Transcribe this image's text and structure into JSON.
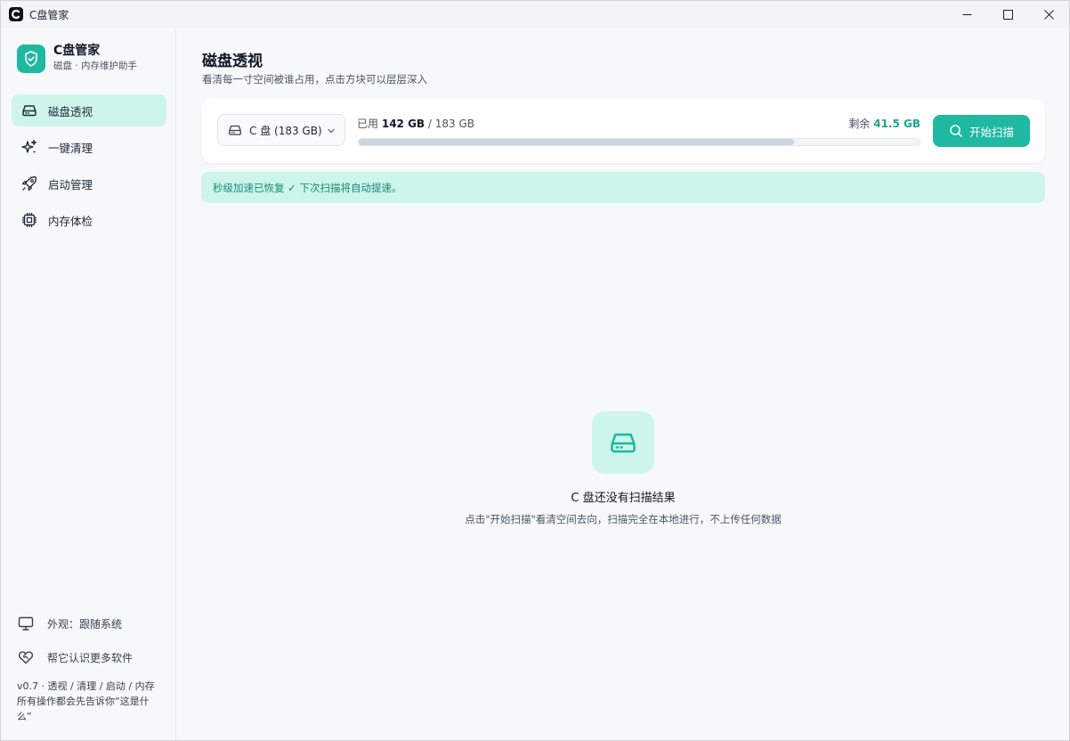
{
  "window": {
    "title": "C盘管家"
  },
  "brand": {
    "name": "C盘管家",
    "subtitle": "磁盘 · 内存维护助手"
  },
  "nav": [
    {
      "label": "磁盘透视",
      "icon": "hard-drive-icon",
      "active": true
    },
    {
      "label": "一键清理",
      "icon": "sparkles-icon",
      "active": false
    },
    {
      "label": "启动管理",
      "icon": "rocket-icon",
      "active": false
    },
    {
      "label": "内存体检",
      "icon": "cpu-chip-icon",
      "active": false
    }
  ],
  "sidebar_bottom": {
    "appearance_label": "外观：跟随系统",
    "appearance_icon": "monitor-icon",
    "share_label": "帮它认识更多软件",
    "share_icon": "heart-handshake-icon",
    "version_note": "v0.7 · 透视 / 清理 / 启动 / 内存 所有操作都会先告诉你“这是什么”"
  },
  "page": {
    "title": "磁盘透视",
    "subtitle": "看清每一寸空间被谁占用，点击方块可以层层深入"
  },
  "disk": {
    "selected_drive": "C 盘 (183 GB)",
    "used_label": "已用",
    "used_value": "142 GB",
    "total_value": "/ 183 GB",
    "free_label": "剩余",
    "free_value": "41.5 GB",
    "used_fraction": 0.776,
    "scan_button": "开始扫描"
  },
  "notice": {
    "text": "秒级加速已恢复 ✓ 下次扫描将自动提速。"
  },
  "empty_state": {
    "icon": "hard-drive-icon",
    "title": "C 盘还没有扫描结果",
    "description": "点击\"开始扫描\"看清空间去向，扫描完全在本地进行，不上传任何数据"
  },
  "colors": {
    "accent": "#1fb8a0",
    "accent_light": "#cdf5ea",
    "accent_text": "#138a74",
    "bar_fill": "#cbd5e1"
  }
}
